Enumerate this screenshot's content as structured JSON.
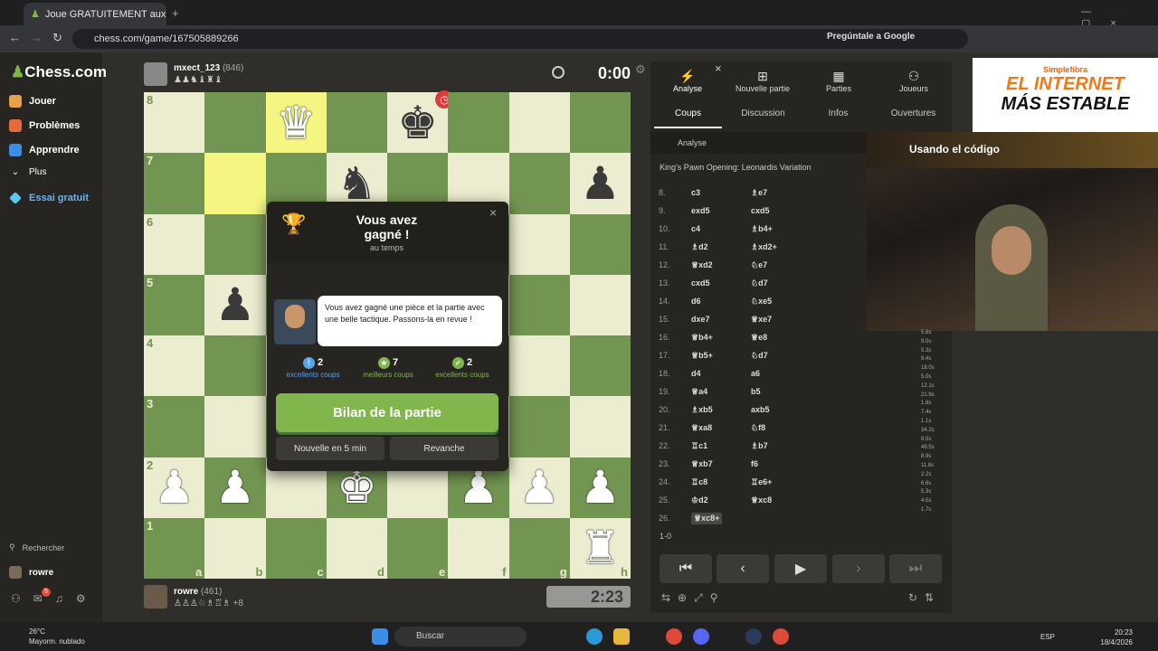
{
  "browser": {
    "tab_title": "Joue GRATUITEMENT aux éche",
    "url": "chess.com/game/167505889266",
    "ask_google": "Pregúntale a Google"
  },
  "sidebar": {
    "logo": "Chess.com",
    "items": [
      {
        "label": "Jouer"
      },
      {
        "label": "Problèmes"
      },
      {
        "label": "Apprendre"
      },
      {
        "label": "Plus"
      },
      {
        "label": "Essai gratuit"
      }
    ],
    "search": "Rechercher",
    "user": "rowre",
    "mail_badge": "5"
  },
  "top_player": {
    "name": "mxect_123",
    "rating": "(846)",
    "clock": "0:00",
    "captured": "♟♟♞♝♜♝"
  },
  "bottom_player": {
    "name": "rowre",
    "rating": "(461)",
    "clock": "2:23",
    "captured": "♙♙♙♘♗♖♗",
    "advantage": "+8"
  },
  "board": {
    "ranks": [
      "8",
      "7",
      "6",
      "5",
      "4",
      "3",
      "2",
      "1"
    ],
    "files": [
      "a",
      "b",
      "c",
      "d",
      "e",
      "f",
      "g",
      "h"
    ]
  },
  "modal": {
    "title": "Vous avez gagné !",
    "subtitle": "au temps",
    "coach_message": "Vous avez gagné une pièce et la partie avec une belle tactique. Passons-la en revue !",
    "stats": [
      {
        "value": "2",
        "label": "excellents coups",
        "color": "#5ba3e6",
        "icon": "!"
      },
      {
        "value": "7",
        "label": "meilleurs coups",
        "color": "#81b64c",
        "icon": "★"
      },
      {
        "value": "2",
        "label": "excellents coups",
        "color": "#81b64c",
        "icon": "👍"
      }
    ],
    "primary_button": "Bilan de la partie",
    "new_game_button": "Nouvelle en 5 min",
    "rematch_button": "Revanche",
    "close": "×"
  },
  "panel": {
    "tabs_top": [
      "Analyse",
      "Nouvelle partie",
      "Parties",
      "Joueurs"
    ],
    "tabs": [
      "Coups",
      "Discussion",
      "Infos",
      "Ouvertures"
    ],
    "analysis_label": "Analyse",
    "opening": "King's Pawn Opening: Leonardis Variation",
    "result": "1-0",
    "moves": [
      {
        "n": "8.",
        "w": "c3",
        "b": "♗e7"
      },
      {
        "n": "9.",
        "w": "exd5",
        "b": "cxd5"
      },
      {
        "n": "10.",
        "w": "c4",
        "b": "♗b4+"
      },
      {
        "n": "11.",
        "w": "♗d2",
        "b": "♗xd2+"
      },
      {
        "n": "12.",
        "w": "♕xd2",
        "b": "♘e7"
      },
      {
        "n": "13.",
        "w": "cxd5",
        "b": "♘d7"
      },
      {
        "n": "14.",
        "w": "d6",
        "b": "♘xe5"
      },
      {
        "n": "15.",
        "w": "dxe7",
        "b": "♕xe7"
      },
      {
        "n": "16.",
        "w": "♕b4+",
        "b": "♕e8"
      },
      {
        "n": "17.",
        "w": "♕b5+",
        "b": "♘d7"
      },
      {
        "n": "18.",
        "w": "d4",
        "b": "a6"
      },
      {
        "n": "19.",
        "w": "♕a4",
        "b": "b5"
      },
      {
        "n": "20.",
        "w": "♗xb5",
        "b": "axb5"
      },
      {
        "n": "21.",
        "w": "♕xa8",
        "b": "♘f8"
      },
      {
        "n": "22.",
        "w": "♖c1",
        "b": "♗b7"
      },
      {
        "n": "23.",
        "w": "♕xb7",
        "b": "f6"
      },
      {
        "n": "24.",
        "w": "♖c8",
        "b": "♖e6+"
      },
      {
        "n": "25.",
        "w": "♔d2",
        "b": "♕xc8"
      },
      {
        "n": "26.",
        "w": "♕xc8+",
        "b": ""
      }
    ],
    "times": [
      "5.8s",
      "9.0s",
      "5.3s",
      "9.4s",
      "18.0s",
      "5.0s",
      "12.1s",
      "21.9s",
      "1.8s",
      "7.4s",
      "1.1s",
      "34.2s",
      "8.5s",
      "49.5s",
      "8.9s",
      "11.8s",
      "2.2s",
      "6.6s",
      "5.3s",
      "4.5s",
      "1.7s"
    ]
  },
  "ad": {
    "brand": "Simplefibra",
    "line1": "EL INTERNET",
    "line2": "MÁS ESTABLE",
    "code": "Usando el código"
  },
  "taskbar": {
    "temp": "26°C",
    "weather": "Mayorm. nublado",
    "search": "Buscar",
    "lang": "ESP",
    "time": "20:23",
    "date": "18/4/2026"
  },
  "colors": {
    "light": "#ebecd0",
    "dark": "#739552",
    "accent": "#81b64c"
  }
}
